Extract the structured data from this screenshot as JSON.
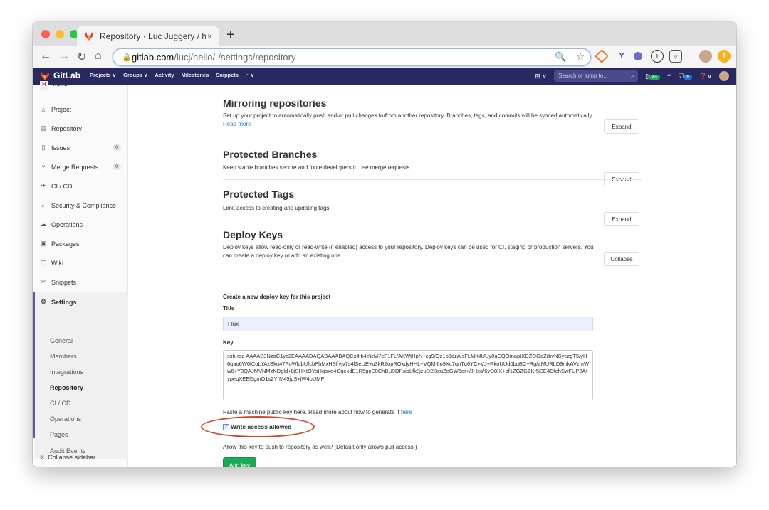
{
  "browser": {
    "tab_title": "Repository · Luc Juggery / hello",
    "tab_close": "×",
    "new_tab": "+",
    "url_host": "gitlab.com",
    "url_path": "/lucj/hello/-/settings/repository"
  },
  "gitlab_header": {
    "brand": "GitLab",
    "nav": [
      "Projects ∨",
      "Groups ∨",
      "Activity",
      "Milestones",
      "Snippets"
    ],
    "search_placeholder": "Search or jump to...",
    "todo_count": "23",
    "issues_count": "5"
  },
  "sidebar": {
    "project_avatar": "H",
    "project_name": "hello",
    "items": [
      {
        "label": "Project",
        "icon": "home-icon"
      },
      {
        "label": "Repository",
        "icon": "doc-icon"
      },
      {
        "label": "Issues",
        "icon": "issues-icon",
        "count": "0"
      },
      {
        "label": "Merge Requests",
        "icon": "merge-icon",
        "count": "0"
      },
      {
        "label": "CI / CD",
        "icon": "rocket-icon"
      },
      {
        "label": "Security & Compliance",
        "icon": "shield-icon"
      },
      {
        "label": "Operations",
        "icon": "cloud-icon"
      },
      {
        "label": "Packages",
        "icon": "package-icon"
      },
      {
        "label": "Wiki",
        "icon": "book-icon"
      },
      {
        "label": "Snippets",
        "icon": "scissors-icon"
      },
      {
        "label": "Settings",
        "icon": "gear-icon"
      }
    ],
    "settings_sub": [
      "General",
      "Members",
      "Integrations",
      "Repository",
      "CI / CD",
      "Operations",
      "Pages",
      "Audit Events"
    ],
    "collapse_label": "Collapse sidebar"
  },
  "sections": {
    "mirroring": {
      "title": "Mirroring repositories",
      "desc": "Set up your project to automatically push and/or pull changes to/from another repository. Branches, tags, and commits will be synced automatically.",
      "read_more": "Read more",
      "button": "Expand"
    },
    "protected_branches": {
      "title": "Protected Branches",
      "desc": "Keep stable branches secure and force developers to use merge requests.",
      "button": "Expand"
    },
    "protected_tags": {
      "title": "Protected Tags",
      "desc": "Limit access to creating and updating tags.",
      "button": "Expand"
    },
    "deploy_keys": {
      "title": "Deploy Keys",
      "desc": "Deploy keys allow read-only or read-write (if enabled) access to your repository. Deploy keys can be used for CI, staging or production servers. You can create a deploy key or add an existing one.",
      "button": "Collapse",
      "create_heading": "Create a new deploy key for this project",
      "title_label": "Title",
      "title_value": "Flux",
      "key_label": "Key",
      "key_value": "ssh-rsa AAAAB3NzaC1yc2EAAAADAQABAAABAQCx4fk4YjcM7cP1FL/AKWtHpN+cg9/Qz1p5dzAlsFLMKilUUy0uCQQmaptXDZQGaZrbvNSyezgT5/yH6qau6W6lCoLYAzBku47PoWlqbUfcbPhMxHSfivjv7s4lSeUE+u3kR2opROxdyHHL+VQMl6n9Xc7qnTq6YC+VJ+RkoUUd0bqBC+Rg/aMURLD9mkAVzmWw6+Y8QAJMVNMzNDgld+8iSHKtOYsHqoxq4GqexdB1R5goE0ChBU9DPsiqLfk8jzuD2l3xuZeGW6or+/JHxa/6vO8IX+of1ZGZGZKr5i3E4OlehSwFUP2A/ypeqXEEl5gmO1s2YrM49jpS+jW4oUMP",
      "key_help_prefix": "Paste a machine public key here. Read more about how to generate it",
      "key_help_link": "here",
      "checkbox_label": "Write access allowed",
      "checkbox_help": "Allow this key to push to repository as well? (Default only allows pull access.)",
      "add_button": "Add key"
    }
  }
}
